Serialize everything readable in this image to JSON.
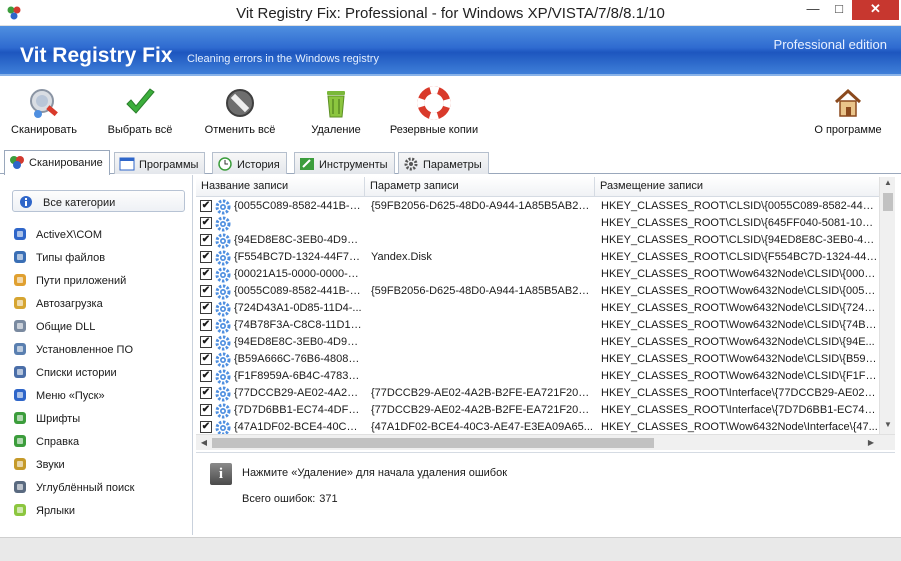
{
  "window": {
    "title": "Vit Registry Fix: Professional - for Windows XP/VISTA/7/8/8.1/10",
    "min_glyph": "—",
    "max_glyph": "□",
    "close_glyph": "✕"
  },
  "banner": {
    "title": "Vit Registry Fix",
    "subtitle": "Cleaning errors in the Windows registry",
    "edition": "Professional edition"
  },
  "toolbar": {
    "scan": "Сканировать",
    "select_all": "Выбрать всё",
    "deselect_all": "Отменить всё",
    "delete": "Удаление",
    "backups": "Резервные копии",
    "about": "О программе"
  },
  "tabs": [
    {
      "label": "Сканирование",
      "icon": "scan-tab-icon"
    },
    {
      "label": "Программы",
      "icon": "window-icon"
    },
    {
      "label": "История",
      "icon": "clock-icon"
    },
    {
      "label": "Инструменты",
      "icon": "tools-icon"
    },
    {
      "label": "Параметры",
      "icon": "gear-icon"
    }
  ],
  "sidebar": {
    "all": "Все категории",
    "items": [
      {
        "label": "ActiveX\\COM",
        "icon": "activex-icon"
      },
      {
        "label": "Типы файлов",
        "icon": "file-types-icon"
      },
      {
        "label": "Пути приложений",
        "icon": "folder-icon"
      },
      {
        "label": "Автозагрузка",
        "icon": "startup-icon"
      },
      {
        "label": "Общие DLL",
        "icon": "dll-icon"
      },
      {
        "label": "Установленное ПО",
        "icon": "installed-software-icon"
      },
      {
        "label": "Списки истории",
        "icon": "history-list-icon"
      },
      {
        "label": "Меню «Пуск»",
        "icon": "start-menu-icon"
      },
      {
        "label": "Шрифты",
        "icon": "font-icon"
      },
      {
        "label": "Справка",
        "icon": "help-icon"
      },
      {
        "label": "Звуки",
        "icon": "sound-icon"
      },
      {
        "label": "Углублённый поиск",
        "icon": "deep-search-icon"
      },
      {
        "label": "Ярлыки",
        "icon": "shortcut-icon"
      }
    ]
  },
  "table": {
    "headers": [
      "Название записи",
      "Параметр записи",
      "Размещение записи"
    ],
    "check_glyph": "✔",
    "rows": [
      {
        "name": "{0055C089-8582-441B-A...",
        "param": "{59FB2056-D625-48D0-A944-1A85B5AB26...",
        "location": "HKEY_CLASSES_ROOT\\CLSID\\{0055C089-8582-441B..."
      },
      {
        "name": "",
        "param": "",
        "location": "HKEY_CLASSES_ROOT\\CLSID\\{645FF040-5081-101B-..."
      },
      {
        "name": "{94ED8E8C-3EB0-4D98-...",
        "param": "",
        "location": "HKEY_CLASSES_ROOT\\CLSID\\{94ED8E8C-3EB0-4D9..."
      },
      {
        "name": "{F554BC7D-1324-44F7-8...",
        "param": "Yandex.Disk",
        "location": "HKEY_CLASSES_ROOT\\CLSID\\{F554BC7D-1324-44F7-..."
      },
      {
        "name": "{00021A15-0000-0000-C...",
        "param": "",
        "location": "HKEY_CLASSES_ROOT\\Wow6432Node\\CLSID\\{0002..."
      },
      {
        "name": "{0055C089-8582-441B-A...",
        "param": "{59FB2056-D625-48D0-A944-1A85B5AB26...",
        "location": "HKEY_CLASSES_ROOT\\Wow6432Node\\CLSID\\{0055..."
      },
      {
        "name": "{724D43A1-0D85-11D4-...",
        "param": "",
        "location": "HKEY_CLASSES_ROOT\\Wow6432Node\\CLSID\\{724d..."
      },
      {
        "name": "{74B78F3A-C8C8-11D1-...",
        "param": "",
        "location": "HKEY_CLASSES_ROOT\\Wow6432Node\\CLSID\\{74B7..."
      },
      {
        "name": "{94ED8E8C-3EB0-4D98-...",
        "param": "",
        "location": "HKEY_CLASSES_ROOT\\Wow6432Node\\CLSID\\{94E..."
      },
      {
        "name": "{B59A666C-76B6-4808-9...",
        "param": "",
        "location": "HKEY_CLASSES_ROOT\\Wow6432Node\\CLSID\\{B59A..."
      },
      {
        "name": "{F1F8959A-6B4C-4783-8...",
        "param": "",
        "location": "HKEY_CLASSES_ROOT\\Wow6432Node\\CLSID\\{F1F8..."
      },
      {
        "name": "{77DCCB29-AE02-4A2B-...",
        "param": "{77DCCB29-AE02-4A2B-B2FE-EA721F209...",
        "location": "HKEY_CLASSES_ROOT\\Interface\\{77DCCB29-AE02-4..."
      },
      {
        "name": "{7D7D6BB1-EC74-4DF0-...",
        "param": "{77DCCB29-AE02-4A2B-B2FE-EA721F209...",
        "location": "HKEY_CLASSES_ROOT\\Interface\\{7D7D6BB1-EC74-4..."
      },
      {
        "name": "{47A1DF02-BCE4-40C3-...",
        "param": "{47A1DF02-BCE4-40C3-AE47-E3EA09A65...",
        "location": "HKEY_CLASSES_ROOT\\Wow6432Node\\Interface\\{47..."
      }
    ]
  },
  "info": {
    "message": "Нажмите «Удаление» для начала удаления ошибок",
    "total_label": "Всего ошибок:",
    "total_value": "371"
  },
  "colors": {
    "banner_top": "#4f8fe0",
    "banner_bottom": "#1d56bf",
    "check": "#3cae3c",
    "delete_red": "#d93a2b"
  }
}
